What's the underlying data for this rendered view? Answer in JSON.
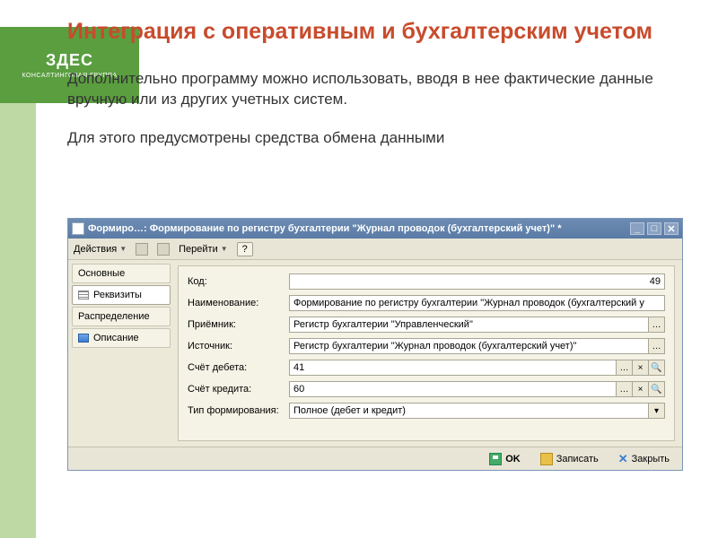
{
  "slide": {
    "title": "Интеграция с оперативным и бухгалтерским учетом",
    "para1": "Дополнительно программу можно использовать, вводя в нее фактические данные вручную или из других учетных систем.",
    "para2": "Для этого предусмотрены средства обмена данными"
  },
  "banner": {
    "brand": "ЗДЕС",
    "sub1": "КОНСАЛТИНГОВАЯ ГРУППА",
    "sub2": ""
  },
  "window": {
    "title": "Формиро…: Формирование по регистру бухгалтерии \"Журнал проводок (бухгалтерский учет)\" *",
    "toolbar": {
      "actions": "Действия",
      "go": "Перейти",
      "help": "?"
    },
    "sidebar": {
      "items": [
        {
          "label": "Основные"
        },
        {
          "label": "Реквизиты"
        },
        {
          "label": "Распределение"
        },
        {
          "label": "Описание"
        }
      ]
    },
    "form": {
      "code_label": "Код:",
      "code_value": "49",
      "name_label": "Наименование:",
      "name_value": "Формирование по регистру бухгалтерии \"Журнал проводок (бухгалтерский у",
      "receiver_label": "Приёмник:",
      "receiver_value": "Регистр бухгалтерии \"Управленческий\"",
      "source_label": "Источник:",
      "source_value": "Регистр бухгалтерии \"Журнал проводок (бухгалтерский учет)\"",
      "debit_label": "Счёт дебета:",
      "debit_value": "41",
      "credit_label": "Счёт кредита:",
      "credit_value": "60",
      "type_label": "Тип формирования:",
      "type_value": "Полное (дебет и кредит)"
    },
    "buttons": {
      "ok": "OK",
      "write": "Записать",
      "close": "Закрыть"
    }
  }
}
